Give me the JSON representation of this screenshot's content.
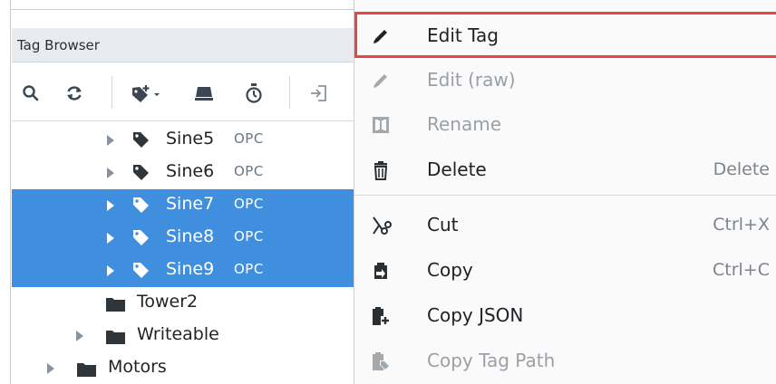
{
  "tag_browser": {
    "title": "Tag Browser",
    "toolbar": [
      {
        "icon": "search-icon"
      },
      {
        "icon": "refresh-icon"
      },
      {
        "icon": "add-tag-icon"
      },
      {
        "icon": "device-icon"
      },
      {
        "icon": "timer-icon"
      },
      {
        "icon": "import-icon"
      }
    ],
    "tree": [
      {
        "name": "Sine5",
        "type": "OPC",
        "kind": "tag",
        "selected": false
      },
      {
        "name": "Sine6",
        "type": "OPC",
        "kind": "tag",
        "selected": false
      },
      {
        "name": "Sine7",
        "type": "OPC",
        "kind": "tag",
        "selected": true
      },
      {
        "name": "Sine8",
        "type": "OPC",
        "kind": "tag",
        "selected": true
      },
      {
        "name": "Sine9",
        "type": "OPC",
        "kind": "tag",
        "selected": true
      },
      {
        "name": "Tower2",
        "kind": "folder",
        "selected": false
      },
      {
        "name": "Writeable",
        "kind": "folder",
        "selected": false
      },
      {
        "name": "Motors",
        "kind": "folder",
        "selected": false
      }
    ]
  },
  "context_menu": {
    "items": [
      {
        "label": "Edit Tag",
        "icon": "pencil-icon",
        "enabled": true,
        "shortcut": "",
        "highlighted": true
      },
      {
        "label": "Edit (raw)",
        "icon": "pencil-icon",
        "enabled": false,
        "shortcut": ""
      },
      {
        "label": "Rename",
        "icon": "rename-icon",
        "enabled": false,
        "shortcut": ""
      },
      {
        "label": "Delete",
        "icon": "trash-icon",
        "enabled": true,
        "shortcut": "Delete"
      },
      {
        "label": "Cut",
        "icon": "scissors-icon",
        "enabled": true,
        "shortcut": "Ctrl+X"
      },
      {
        "label": "Copy",
        "icon": "copy-icon",
        "enabled": true,
        "shortcut": "Ctrl+C"
      },
      {
        "label": "Copy JSON",
        "icon": "clipboard-plus-icon",
        "enabled": true,
        "shortcut": ""
      },
      {
        "label": "Copy Tag Path",
        "icon": "clipboard-tag-icon",
        "enabled": false,
        "shortcut": ""
      }
    ]
  },
  "colors": {
    "selection": "#3f8fde",
    "highlight_box": "#e64646",
    "disabled_text": "#9aa0a6"
  }
}
